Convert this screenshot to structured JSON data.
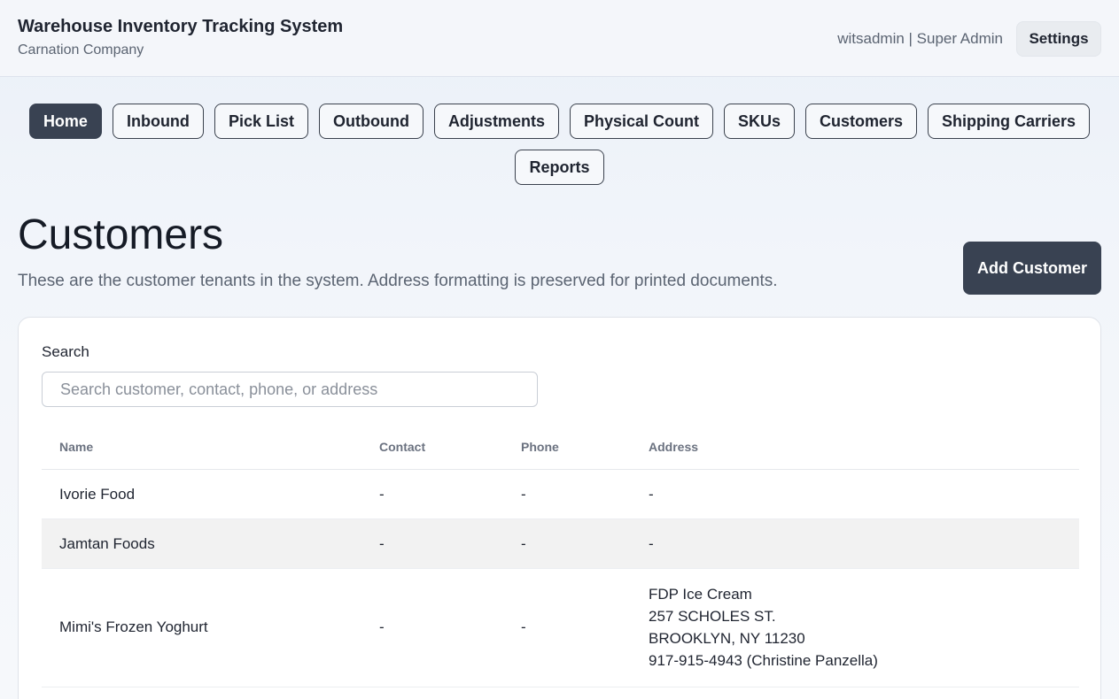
{
  "header": {
    "app_title": "Warehouse Inventory Tracking System",
    "company": "Carnation Company",
    "user": "witsadmin | Super Admin",
    "settings_label": "Settings"
  },
  "nav": {
    "items": [
      "Home",
      "Inbound",
      "Pick List",
      "Outbound",
      "Adjustments",
      "Physical Count",
      "SKUs",
      "Customers",
      "Shipping Carriers",
      "Reports"
    ],
    "active": "Home"
  },
  "page": {
    "title": "Customers",
    "description": "These are the customer tenants in the system. Address formatting is preserved for printed documents.",
    "add_button": "Add Customer"
  },
  "search": {
    "label": "Search",
    "placeholder": "Search customer, contact, phone, or address",
    "value": ""
  },
  "table": {
    "headers": [
      "Name",
      "Contact",
      "Phone",
      "Address"
    ],
    "rows": [
      {
        "name": "Ivorie Food",
        "contact": "-",
        "phone": "-",
        "address": [
          "-"
        ]
      },
      {
        "name": "Jamtan Foods",
        "contact": "-",
        "phone": "-",
        "address": [
          "-"
        ]
      },
      {
        "name": "Mimi's Frozen Yoghurt",
        "contact": "-",
        "phone": "-",
        "address": [
          "FDP Ice Cream",
          "257 SCHOLES ST.",
          "BROOKLYN, NY 11230",
          "917-915-4943 (Christine Panzella)"
        ]
      }
    ]
  }
}
